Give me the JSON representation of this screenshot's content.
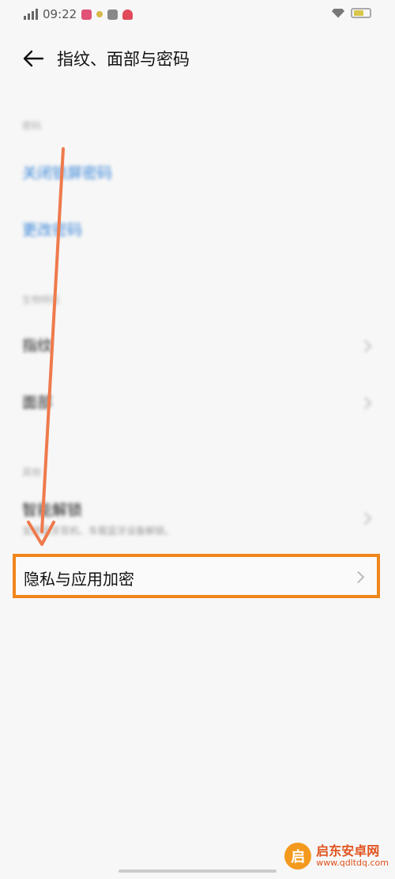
{
  "status_bar": {
    "time": "09:22"
  },
  "header": {
    "title": "指纹、面部与密码"
  },
  "sections": {
    "password": {
      "label": "密码",
      "items": [
        {
          "label": "关闭锁屏密码"
        },
        {
          "label": "更改密码"
        }
      ]
    },
    "biometrics": {
      "label": "生物特征",
      "items": [
        {
          "label": "指纹"
        },
        {
          "label": "面部"
        }
      ]
    },
    "other": {
      "label": "其他",
      "items": [
        {
          "label": "智能解锁",
          "sub": "支持蓝牙耳机、车载蓝牙设备解锁。"
        }
      ]
    }
  },
  "highlight_row": {
    "label": "隐私与应用加密"
  },
  "watermark": {
    "name": "启东安卓网",
    "url": "www.qdltdq.com",
    "logo_char": "启"
  },
  "colors": {
    "accent_link": "#3b86d8",
    "highlight_border": "#f0861b",
    "arrow": "#ef7a4c"
  }
}
